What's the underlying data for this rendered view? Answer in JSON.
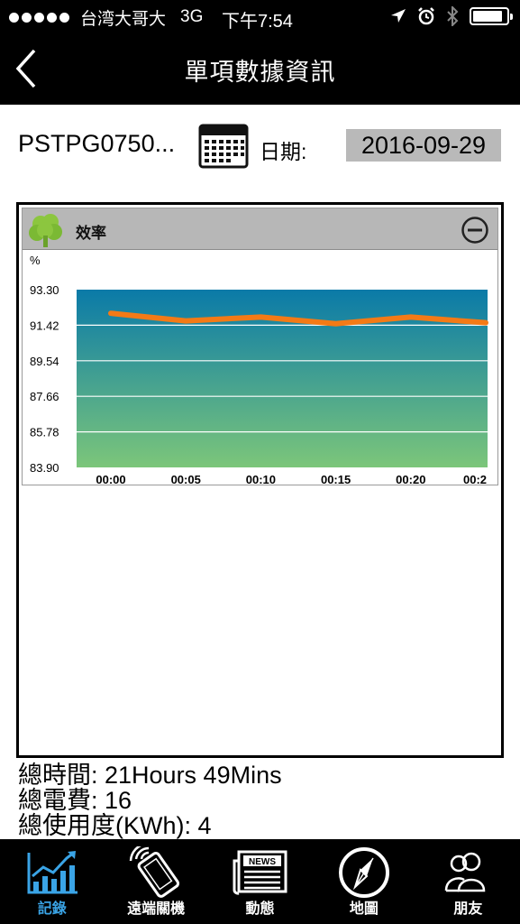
{
  "status_bar": {
    "carrier": "台湾大哥大",
    "network": "3G",
    "time": "下午7:54",
    "battery_level": 0.9
  },
  "nav": {
    "title": "單項數據資訊"
  },
  "device": {
    "name": "PSTPG0750...",
    "date_label": "日期:",
    "date_value": "2016-09-29"
  },
  "panel": {
    "title": "效率",
    "colors": {
      "header_bg": "#b7b7b7",
      "gradient_top": "#0a7aa8",
      "gradient_bottom": "#7cc67a",
      "line": "#f47a16"
    }
  },
  "chart_data": {
    "type": "line",
    "ylabel": "%",
    "yticks": [
      "93.30",
      "91.42",
      "89.54",
      "87.66",
      "85.78",
      "83.90"
    ],
    "ylim": [
      83.9,
      93.3
    ],
    "xticks": [
      "00:00",
      "00:05",
      "00:10",
      "00:15",
      "00:20",
      "00:2"
    ],
    "x": [
      0,
      1,
      2,
      3,
      4,
      5
    ],
    "series": [
      {
        "values": [
          92.05,
          91.65,
          91.85,
          91.5,
          91.85,
          91.55
        ]
      }
    ],
    "grid": true
  },
  "summary": {
    "total_time": "總時間: 21Hours 49Mins",
    "total_fee": "總電費: 16",
    "total_usage": "總使用度(KWh): 4"
  },
  "tabs": [
    {
      "label": "記錄",
      "icon": "chart-record-icon",
      "active": true
    },
    {
      "label": "遠端關機",
      "icon": "remote-phone-icon",
      "active": false
    },
    {
      "label": "動態",
      "icon": "news-icon",
      "active": false
    },
    {
      "label": "地圖",
      "icon": "compass-icon",
      "active": false
    },
    {
      "label": "朋友",
      "icon": "friends-icon",
      "active": false
    }
  ]
}
